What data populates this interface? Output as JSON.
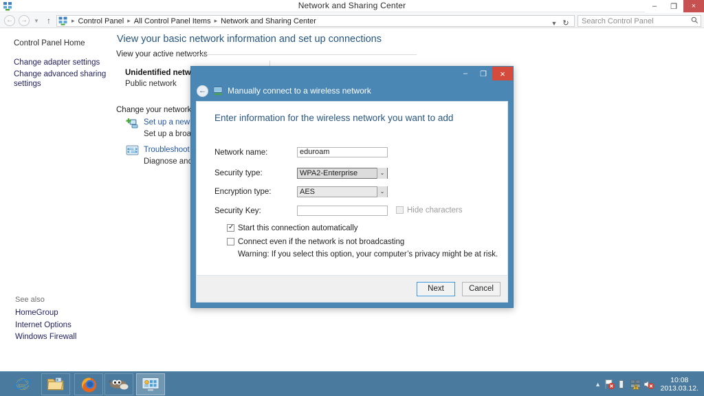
{
  "window": {
    "title": "Network and Sharing Center",
    "app_icon": "network-icon",
    "controls": {
      "minimize": "–",
      "maximize": "❐",
      "close": "×"
    }
  },
  "addressbar": {
    "back_icon": "back-arrow-icon",
    "forward_icon": "forward-arrow-icon",
    "recent_icon": "chevron-down-icon",
    "up_icon": "up-arrow-icon",
    "crumb_icon": "control-panel-icon",
    "breadcrumbs": [
      "Control Panel",
      "All Control Panel Items",
      "Network and Sharing Center"
    ],
    "separator": "▸",
    "dropdown_icon": "chevron-down-icon",
    "refresh_icon": "refresh-icon",
    "refresh_glyph": "↻"
  },
  "search": {
    "placeholder": "Search Control Panel",
    "icon": "search-icon",
    "glyph": "⚲"
  },
  "sidebar": {
    "items": [
      {
        "label": "Control Panel Home"
      },
      {
        "label": "Change adapter settings"
      },
      {
        "label": "Change advanced sharing settings"
      }
    ],
    "see_also_label": "See also",
    "see_also": [
      {
        "label": "HomeGroup"
      },
      {
        "label": "Internet Options"
      },
      {
        "label": "Windows Firewall"
      }
    ]
  },
  "main": {
    "heading": "View your basic network information and set up connections",
    "active_networks_label": "View your active networks",
    "network": {
      "name": "Unidentified network",
      "type": "Public network"
    },
    "change_settings_label": "Change your networking se",
    "tasks": [
      {
        "icon": "setup-new-connection-icon",
        "link": "Set up a new con",
        "sub": "Set up a broadba"
      },
      {
        "icon": "troubleshoot-icon",
        "link": "Troubleshoot pro",
        "sub": "Diagnose and rep"
      }
    ]
  },
  "dialog": {
    "caption_title": "Manually connect to a wireless network",
    "caption_icon": "wireless-network-icon",
    "back_icon": "back-arrow-icon",
    "back_glyph": "←",
    "controls": {
      "minimize": "–",
      "maximize": "❐",
      "close": "×"
    },
    "heading": "Enter information for the wireless network you want to add",
    "fields": [
      {
        "label": "Network name:",
        "value": "eduroam",
        "type": "text"
      },
      {
        "label": "Security type:",
        "value": "WPA2-Enterprise",
        "type": "select"
      },
      {
        "label": "Encryption type:",
        "value": "AES",
        "type": "select"
      },
      {
        "label": "Security Key:",
        "value": "",
        "type": "text"
      }
    ],
    "hide_characters": {
      "label": "Hide characters",
      "checked": false,
      "enabled": false
    },
    "checkboxes": [
      {
        "label": "Start this connection automatically",
        "checked": true
      },
      {
        "label": "Connect even if the network is not broadcasting",
        "checked": false
      }
    ],
    "warning": "Warning: If you select this option, your computer’s privacy might be at risk.",
    "buttons": {
      "next": "Next",
      "cancel": "Cancel"
    },
    "dropdown_glyph": "⌄"
  },
  "taskbar": {
    "items": [
      {
        "name": "internet-explorer",
        "state": "pinned"
      },
      {
        "name": "file-explorer",
        "state": "open"
      },
      {
        "name": "firefox",
        "state": "open"
      },
      {
        "name": "gimp",
        "state": "open"
      },
      {
        "name": "control-panel",
        "state": "active"
      }
    ],
    "tray": {
      "show_hidden_glyph": "▲",
      "icons": [
        "action-center-flag-icon",
        "battery-icon",
        "network-warning-icon",
        "volume-muted-icon"
      ]
    },
    "clock": {
      "time": "10:08",
      "date": "2013.03.12."
    }
  },
  "colors": {
    "accent_blue": "#4a87b4",
    "heading_blue": "#26557f",
    "link_blue": "#2255a0",
    "close_red": "#c75050",
    "dialog_close_red": "#d44a3c",
    "taskbar": "#4a7b9e"
  }
}
